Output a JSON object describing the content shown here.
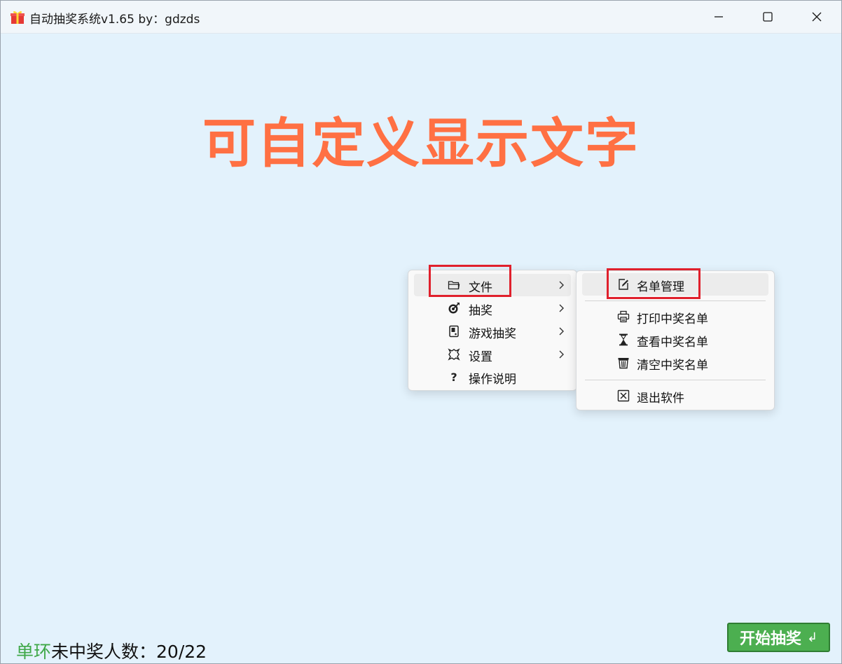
{
  "window": {
    "title": "自动抽奖系统v1.65  by：gdzds",
    "app_icon": "gift-icon"
  },
  "banner": {
    "text": "可自定义显示文字",
    "color": "#ff7043"
  },
  "context_menu": {
    "items": [
      {
        "label": "文件",
        "icon": "folder-icon",
        "has_submenu": true
      },
      {
        "label": "抽奖",
        "icon": "target-icon",
        "has_submenu": true
      },
      {
        "label": "游戏抽奖",
        "icon": "game-icon",
        "has_submenu": true
      },
      {
        "label": "设置",
        "icon": "gear-icon",
        "has_submenu": true
      },
      {
        "label": "操作说明",
        "icon": "question-icon",
        "has_submenu": false
      }
    ],
    "submenu": {
      "items": [
        {
          "label": "名单管理",
          "icon": "edit-icon"
        },
        {
          "label": "打印中奖名单",
          "icon": "printer-icon"
        },
        {
          "label": "查看中奖名单",
          "icon": "hourglass-icon"
        },
        {
          "label": "清空中奖名单",
          "icon": "trash-icon"
        },
        {
          "label": "退出软件",
          "icon": "close-box-icon"
        }
      ]
    }
  },
  "status": {
    "mode": "单环",
    "label": "未中奖人数：",
    "value": "20/22",
    "mode_color": "#3fa848"
  },
  "start_button": {
    "label": "开始抽奖",
    "shortcut_glyph": "↲",
    "color": "#4caf50"
  }
}
